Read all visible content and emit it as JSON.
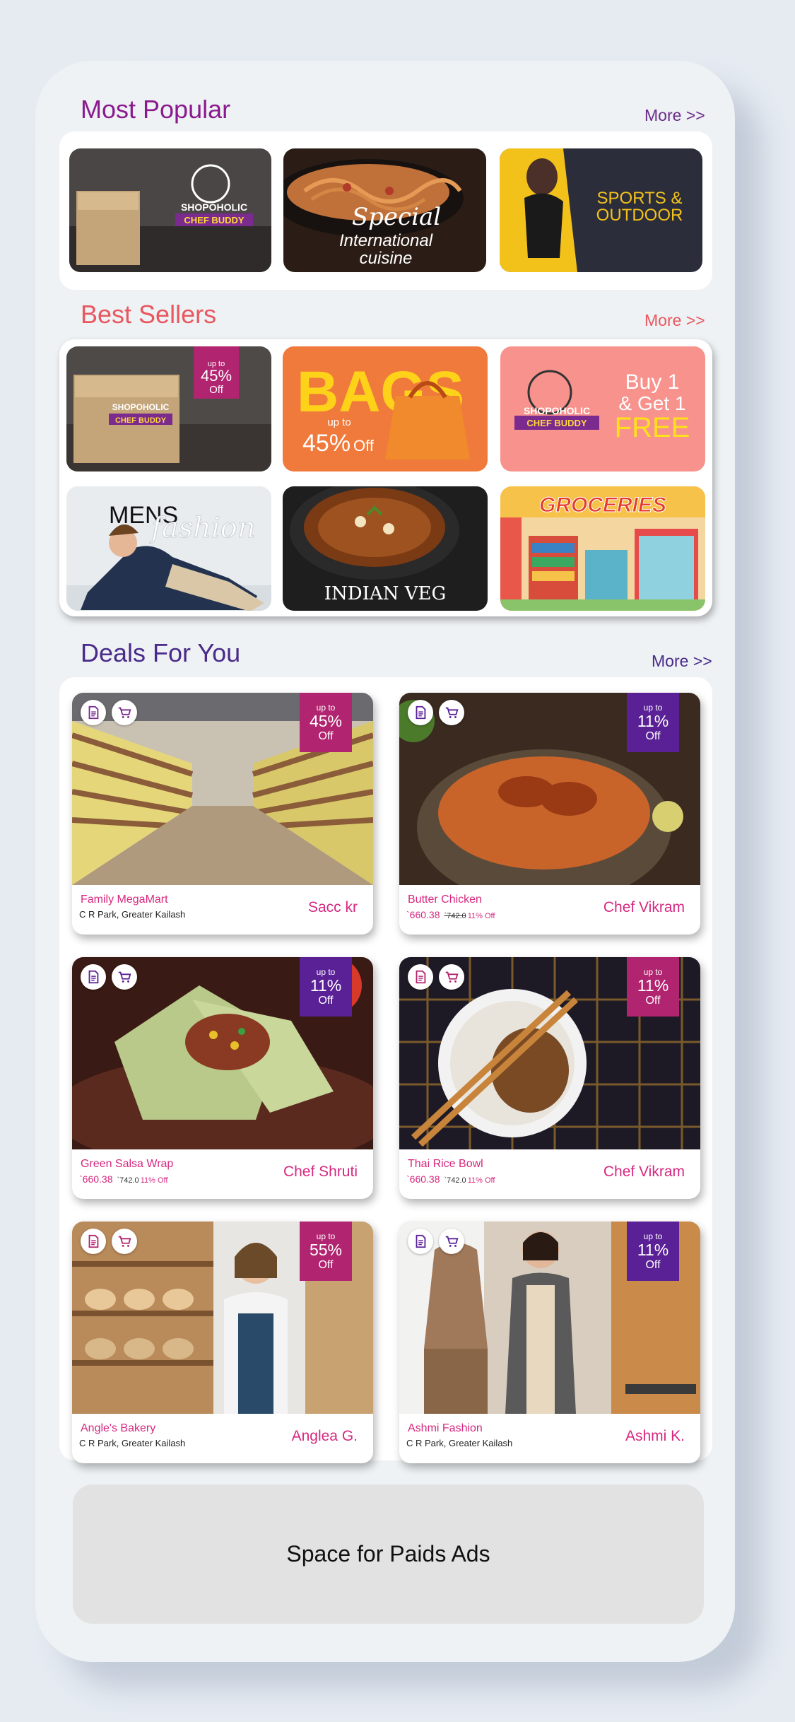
{
  "sections": {
    "popular": {
      "title": "Most Popular",
      "more": "More >>",
      "title_color": "#8a1a8e",
      "more_color": "#6a2c8a"
    },
    "best": {
      "title": "Best Sellers",
      "more": "More >>",
      "title_color": "#e8575f",
      "more_color": "#e8575f"
    },
    "deals": {
      "title": "Deals For You",
      "more": "More >>",
      "title_color": "#4a2a8a",
      "more_color": "#4a2a8a"
    }
  },
  "popular_banners": [
    {
      "name": "chef-buddy-banner",
      "lines": [
        "SHOPOHOLIC",
        "CHEF BUDDY"
      ]
    },
    {
      "name": "international-cuisine-banner",
      "lines": [
        "Special",
        "International",
        "cuisine"
      ]
    },
    {
      "name": "sports-outdoor-banner",
      "lines": [
        "SPORTS &",
        "OUTDOOR"
      ]
    }
  ],
  "best_banners": [
    {
      "name": "chef-buddy-offer",
      "badge": {
        "s1": "up to",
        "s2": "45%",
        "s3": "Off"
      },
      "lines": [
        "SHOPOHOLIC",
        "CHEF BUDDY"
      ]
    },
    {
      "name": "bags-offer",
      "lines": [
        "BAGS",
        "up to",
        "45%",
        "Off"
      ]
    },
    {
      "name": "buy1-get1-offer",
      "lines": [
        "Buy 1",
        "& Get 1",
        "FREE",
        "SHOPOHOLIC",
        "CHEF BUDDY"
      ]
    },
    {
      "name": "mens-fashion-banner",
      "lines": [
        "MENS",
        "fashion"
      ]
    },
    {
      "name": "indian-veg-banner",
      "lines": [
        "INDIAN VEG"
      ]
    },
    {
      "name": "groceries-banner",
      "lines": [
        "GROCERIES"
      ]
    }
  ],
  "deals": [
    {
      "title": "Family MegaMart",
      "sub": "C R Park, Greater Kailash",
      "right": "Sacc kr",
      "badge": {
        "s1": "up to",
        "s2": "45%",
        "s3": "Off"
      }
    },
    {
      "title": "Butter Chicken",
      "price": "`660.38",
      "old": "`742.0",
      "pct": "11% Off",
      "right": "Chef Vikram",
      "badge": {
        "s1": "up to",
        "s2": "11%",
        "s3": "Off"
      }
    },
    {
      "title": "Green Salsa Wrap",
      "price": "`660.38",
      "old": "`742.0",
      "pct": "11% Off",
      "right": "Chef Shruti",
      "badge": {
        "s1": "up to",
        "s2": "11%",
        "s3": "Off"
      }
    },
    {
      "title": "Thai Rice Bowl",
      "price": "`660.38",
      "old": "`742.0",
      "pct": "11% Off",
      "right": "Chef Vikram",
      "badge": {
        "s1": "up to",
        "s2": "11%",
        "s3": "Off"
      }
    },
    {
      "title": "Angle's Bakery",
      "sub": "C R Park, Greater Kailash",
      "right": "Anglea G.",
      "badge": {
        "s1": "up to",
        "s2": "55%",
        "s3": "Off"
      }
    },
    {
      "title": "Ashmi Fashion",
      "sub": "C R Park, Greater Kailash",
      "right": "Ashmi K.",
      "badge": {
        "s1": "up to",
        "s2": "11%",
        "s3": "Off"
      }
    }
  ],
  "ads": {
    "text": "Space for Paids Ads"
  },
  "colors": {
    "accent": "#d6287f",
    "badge_magenta": "#b1246f",
    "badge_purple": "#5a2196",
    "bg": "#e6ebf2"
  },
  "icons": [
    "document-icon",
    "cart-icon"
  ]
}
